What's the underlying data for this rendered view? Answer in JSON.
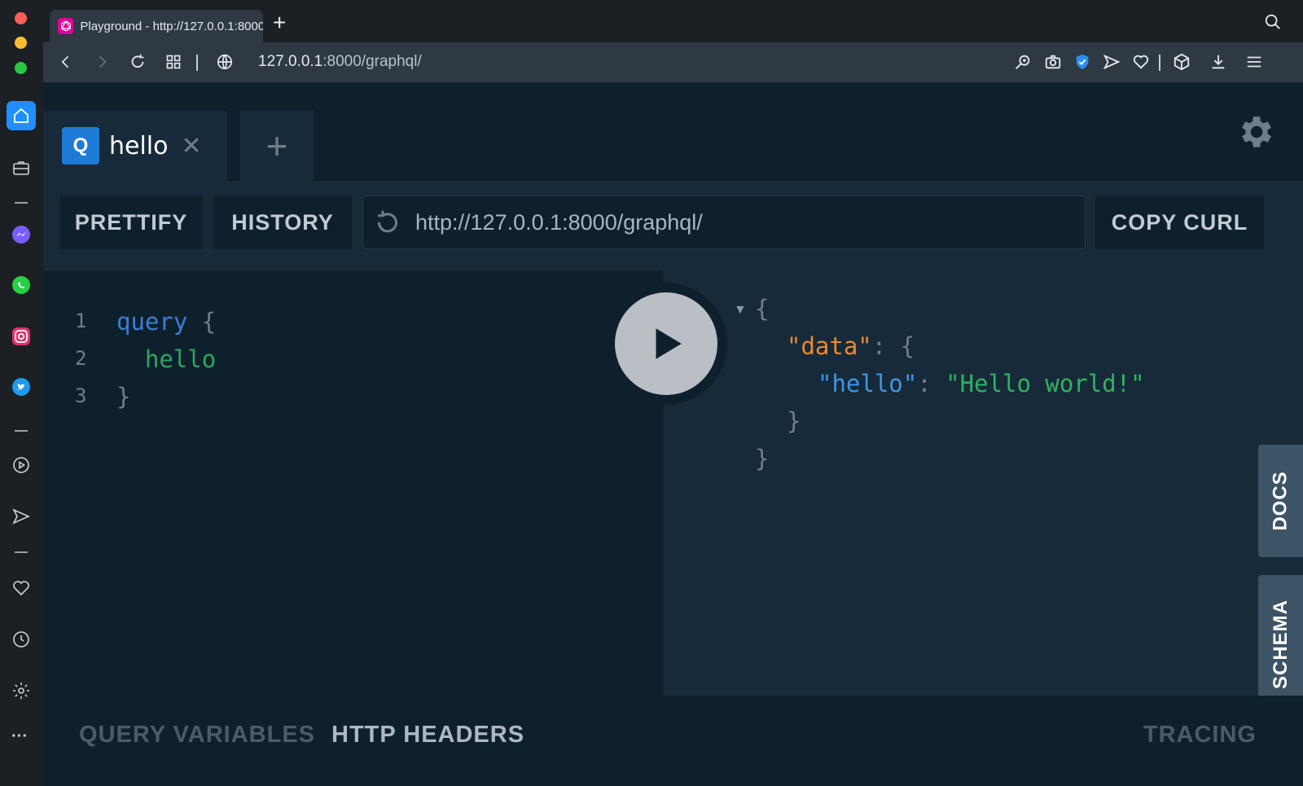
{
  "browser": {
    "tab_title": "Playground - http://127.0.0.1:8000",
    "new_tab_label": "+",
    "url_host": "127.0.0.1",
    "url_path": ":8000/graphql/"
  },
  "sidebar": {
    "icons": [
      "home-icon",
      "briefcase-icon",
      "messenger-icon",
      "whatsapp-icon",
      "instagram-icon",
      "twitter-icon",
      "player-icon",
      "send-icon",
      "heart-icon",
      "clock-icon",
      "settings-icon",
      "more-icon"
    ],
    "more_label": "···"
  },
  "playground": {
    "tab": {
      "badge": "Q",
      "name": "hello",
      "close": "✕"
    },
    "add_tab": "+",
    "toolbar": {
      "prettify": "PRETTIFY",
      "history": "HISTORY",
      "endpoint": "http://127.0.0.1:8000/graphql/",
      "copy_curl": "COPY CURL"
    },
    "query_lines": [
      {
        "num": "1",
        "text": "query {"
      },
      {
        "num": "2",
        "text": "  hello"
      },
      {
        "num": "3",
        "text": "}"
      }
    ],
    "result": {
      "open_brace": "{",
      "data_key": "\"data\"",
      "hello_key": "\"hello\"",
      "hello_value": "\"Hello world!\"",
      "inner_close": "}",
      "outer_close": "}"
    },
    "side_tabs": {
      "docs": "DOCS",
      "schema": "SCHEMA"
    },
    "bottom": {
      "query_variables": "QUERY VARIABLES",
      "http_headers": "HTTP HEADERS",
      "tracing": "TRACING"
    }
  },
  "colors": {
    "keyword": "#3a7fd2",
    "field": "#2ea55f",
    "key_orange": "#e88a2c",
    "key_blue": "#3e97e4",
    "string_green": "#2fb35f",
    "punct": "#6f7e8c"
  }
}
